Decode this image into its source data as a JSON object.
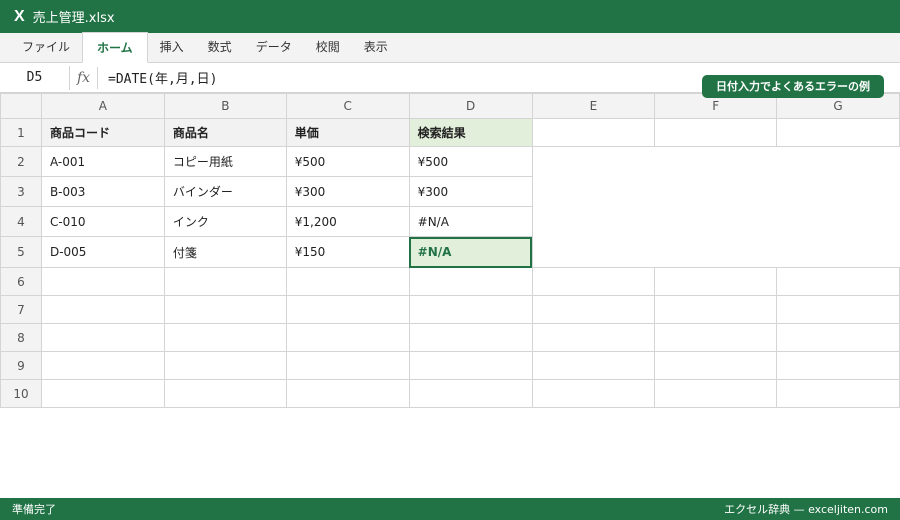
{
  "app": {
    "icon_letter": "X",
    "title": "売上管理.xlsx"
  },
  "ribbon": {
    "tabs": [
      "ファイル",
      "ホーム",
      "挿入",
      "数式",
      "データ",
      "校閲",
      "表示"
    ],
    "active_index": 1
  },
  "formula_bar": {
    "cell_ref": "D5",
    "fx_label": "fx",
    "formula": "=DATE(年,月,日)"
  },
  "badge": "日付入力でよくあるエラーの例",
  "sheet": {
    "columns": [
      "A",
      "B",
      "C",
      "D",
      "E",
      "F",
      "G"
    ],
    "rows": [
      {
        "num": "1",
        "cells": [
          "商品コード",
          "商品名",
          "単価",
          "検索結果"
        ]
      },
      {
        "num": "2",
        "cells": [
          "A-001",
          "コピー用紙",
          "¥500",
          "¥500"
        ]
      },
      {
        "num": "3",
        "cells": [
          "B-003",
          "バインダー",
          "¥300",
          "¥300"
        ]
      },
      {
        "num": "4",
        "cells": [
          "C-010",
          "インク",
          "¥1,200",
          "#N/A"
        ]
      },
      {
        "num": "5",
        "cells": [
          "D-005",
          "付箋",
          "¥150",
          "#N/A"
        ]
      },
      {
        "num": "6",
        "cells": []
      },
      {
        "num": "7",
        "cells": []
      },
      {
        "num": "8",
        "cells": []
      },
      {
        "num": "9",
        "cells": []
      },
      {
        "num": "10",
        "cells": []
      }
    ],
    "selected_cell": "D5"
  },
  "status": {
    "left": "準備完了",
    "right": "エクセル辞典 — exceljiten.com"
  },
  "colors": {
    "accent": "#217346",
    "header_fill": "#f2f2f2",
    "highlight_fill": "#e2efda"
  }
}
